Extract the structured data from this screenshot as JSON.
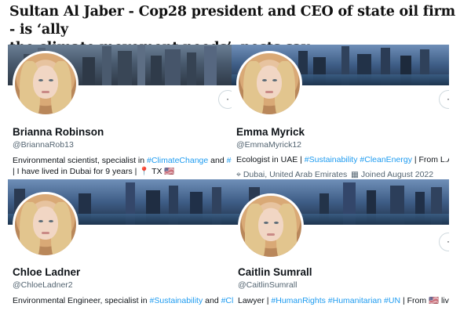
{
  "headline": {
    "line1": "Sultan Al Jaber - Cop28 president and CEO of state oil firm - is ‘ally",
    "line2": "the climate movement needs’, posts say"
  },
  "cards": [
    {
      "name": "Brianna Robinson",
      "handle": "@BriannaRob13",
      "bio_line1_pre": "Environmental scientist, specialist in ",
      "bio_line1_tag1": "#ClimateChange",
      "bio_line1_mid": " and ",
      "bio_line1_tag2": "#Climat",
      "bio_line2": "| I have lived in Dubai for 9 years | 📍 TX 🇺🇸",
      "more_icon": "·"
    },
    {
      "name": "Emma Myrick",
      "handle": "@EmmaMyrick12",
      "bio_pre": "Ecologist in UAE | ",
      "bio_tag1": "#Sustainability",
      "bio_sep": " ",
      "bio_tag2": "#CleanEnergy",
      "bio_post": " | From L.A🇺🇸",
      "location": "⌖ Dubai, United Arab Emirates",
      "joined": "▦ Joined August 2022",
      "more_icon": "·"
    },
    {
      "name": "Chloe Ladner",
      "handle": "@ChloeLadner2",
      "bio_pre": "Environmental Engineer, specialist in ",
      "bio_tag1": "#Sustainability",
      "bio_mid": " and ",
      "bio_tag2": "#CleanEn"
    },
    {
      "name": "Caitlin Sumrall",
      "handle": "@CaitlinSumrall",
      "bio_pre": "Lawyer | ",
      "bio_tag1": "#HumanRights",
      "bio_sep1": " ",
      "bio_tag2": "#Humanitarian",
      "bio_sep2": " ",
      "bio_tag3": "#UN",
      "bio_post": " | From 🇺🇸 living in UAE",
      "more_icon": "·"
    }
  ],
  "colors": {
    "link": "#1d9bf0",
    "secondary_text": "#536471",
    "primary_text": "#0f1419"
  }
}
